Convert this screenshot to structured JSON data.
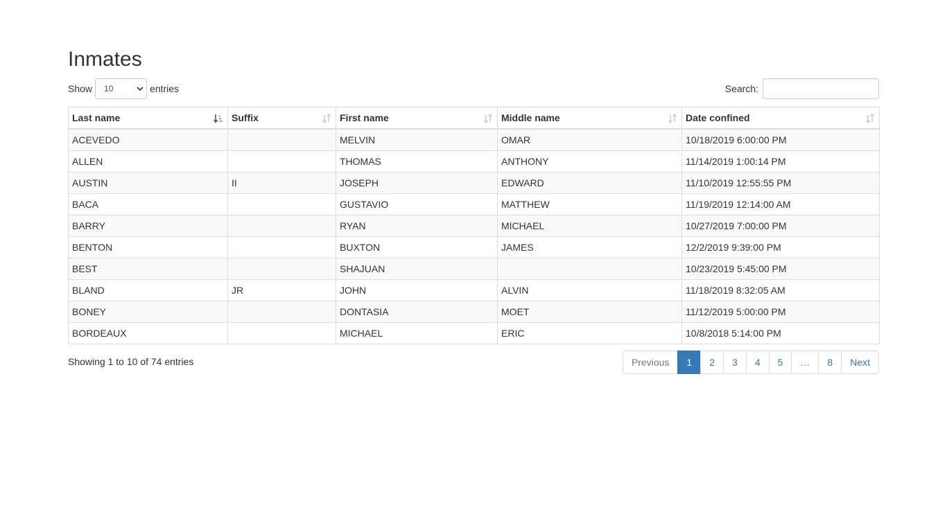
{
  "page": {
    "title": "Inmates"
  },
  "length": {
    "show_label": "Show",
    "value": "10",
    "entries_label": "entries"
  },
  "search": {
    "label": "Search:",
    "value": "",
    "placeholder": ""
  },
  "table": {
    "columns": [
      "Last name",
      "Suffix",
      "First name",
      "Middle name",
      "Date confined"
    ],
    "sorted_column": 0,
    "rows": [
      [
        "ACEVEDO",
        "",
        "MELVIN",
        "OMAR",
        "10/18/2019 6:00:00 PM"
      ],
      [
        "ALLEN",
        "",
        "THOMAS",
        "ANTHONY",
        "11/14/2019 1:00:14 PM"
      ],
      [
        "AUSTIN",
        "II",
        "JOSEPH",
        "EDWARD",
        "11/10/2019 12:55:55 PM"
      ],
      [
        "BACA",
        "",
        "GUSTAVIO",
        "MATTHEW",
        "11/19/2019 12:14:00 AM"
      ],
      [
        "BARRY",
        "",
        "RYAN",
        "MICHAEL",
        "10/27/2019 7:00:00 PM"
      ],
      [
        "BENTON",
        "",
        "BUXTON",
        "JAMES",
        "12/2/2019 9:39:00 PM"
      ],
      [
        "BEST",
        "",
        "SHAJUAN",
        "",
        "10/23/2019 5:45:00 PM"
      ],
      [
        "BLAND",
        "JR",
        "JOHN",
        "ALVIN",
        "11/18/2019 8:32:05 AM"
      ],
      [
        "BONEY",
        "",
        "DONTASIA",
        "MOET",
        "11/12/2019 5:00:00 PM"
      ],
      [
        "BORDEAUX",
        "",
        "MICHAEL",
        "ERIC",
        "10/8/2018 5:14:00 PM"
      ]
    ]
  },
  "info": "Showing 1 to 10 of 74 entries",
  "pagination": {
    "previous": "Previous",
    "pages": [
      "1",
      "2",
      "3",
      "4",
      "5",
      "…",
      "8"
    ],
    "active": "1",
    "next": "Next"
  },
  "colors": {
    "accent": "#337ab7",
    "border": "#dddddd",
    "stripe": "#f9f9f9",
    "text": "#333333"
  }
}
